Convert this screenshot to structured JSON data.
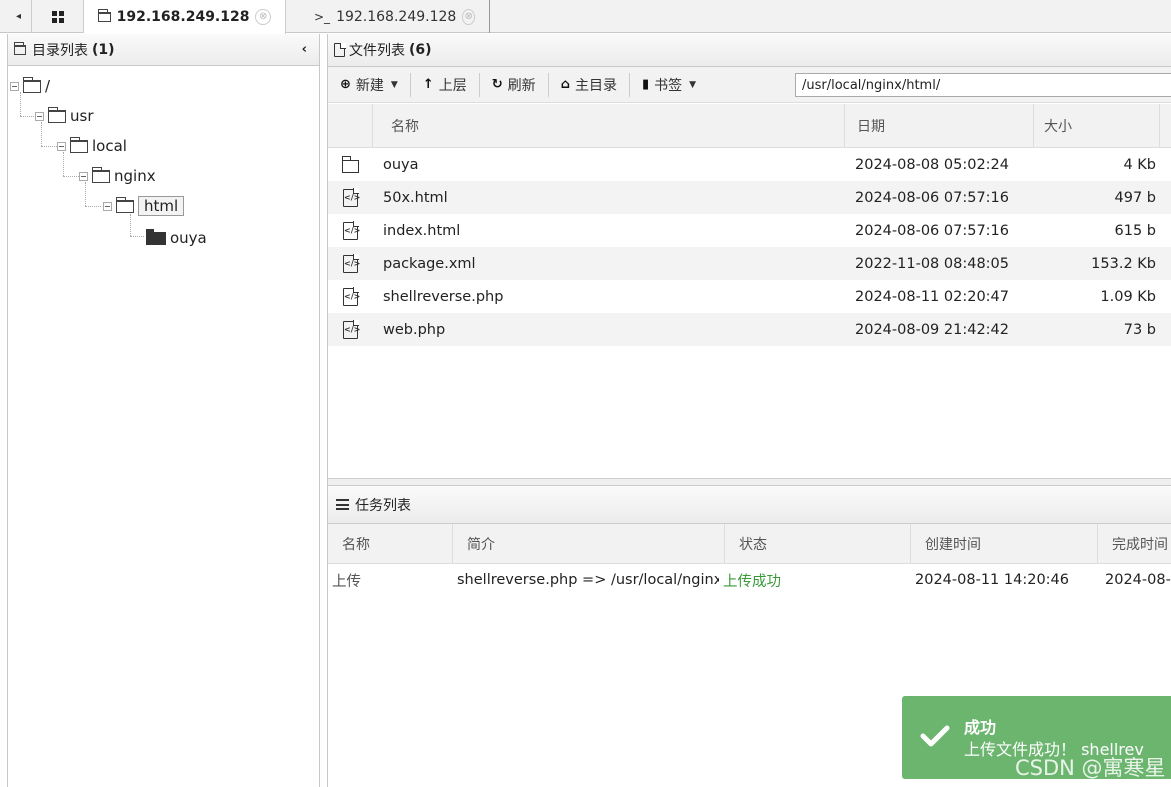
{
  "tabs": {
    "back_arrow": "◂",
    "active_label": "192.168.249.128",
    "terminal_label": "192.168.249.128",
    "terminal_prefix": ">_",
    "close_glyph": "⊗"
  },
  "left_panel": {
    "title": "目录列表",
    "count": "(1)",
    "collapse_glyph": "‹",
    "tree": [
      {
        "label": "/",
        "depth": 0
      },
      {
        "label": "usr",
        "depth": 1
      },
      {
        "label": "local",
        "depth": 2
      },
      {
        "label": "nginx",
        "depth": 3
      },
      {
        "label": "html",
        "depth": 4,
        "selected": true
      },
      {
        "label": "ouya",
        "depth": 5
      }
    ]
  },
  "file_panel": {
    "title": "文件列表",
    "count": "(6)",
    "toolbar": {
      "new_label": "新建",
      "up_label": "上层",
      "refresh_label": "刷新",
      "home_label": "主目录",
      "bookmark_label": "书签",
      "path_value": "/usr/local/nginx/html/"
    },
    "columns": {
      "name": "名称",
      "date": "日期",
      "size": "大小"
    },
    "files": [
      {
        "type": "dir",
        "name": "ouya",
        "date": "2024-08-08 05:02:24",
        "size": "4 Kb"
      },
      {
        "type": "file",
        "name": "50x.html",
        "date": "2024-08-06 07:57:16",
        "size": "497 b"
      },
      {
        "type": "file",
        "name": "index.html",
        "date": "2024-08-06 07:57:16",
        "size": "615 b"
      },
      {
        "type": "file",
        "name": "package.xml",
        "date": "2022-11-08 08:48:05",
        "size": "153.2 Kb"
      },
      {
        "type": "file",
        "name": "shellreverse.php",
        "date": "2024-08-11 02:20:47",
        "size": "1.09 Kb"
      },
      {
        "type": "file",
        "name": "web.php",
        "date": "2024-08-09 21:42:42",
        "size": "73 b"
      }
    ]
  },
  "task_panel": {
    "title": "任务列表",
    "columns": {
      "name": "名称",
      "desc": "简介",
      "status": "状态",
      "created": "创建时间",
      "finished": "完成时间"
    },
    "rows": [
      {
        "name": "上传",
        "desc": "shellreverse.php => /usr/local/nginx/",
        "status": "上传成功",
        "created": "2024-08-11 14:20:46",
        "finished": "2024-08-"
      }
    ]
  },
  "toast": {
    "title": "成功",
    "message": "上传文件成功！ shellrev",
    "color": "#6bb56f"
  },
  "watermark": "CSDN @寓寒星",
  "colors": {
    "status_success": "#3a9a3a"
  }
}
